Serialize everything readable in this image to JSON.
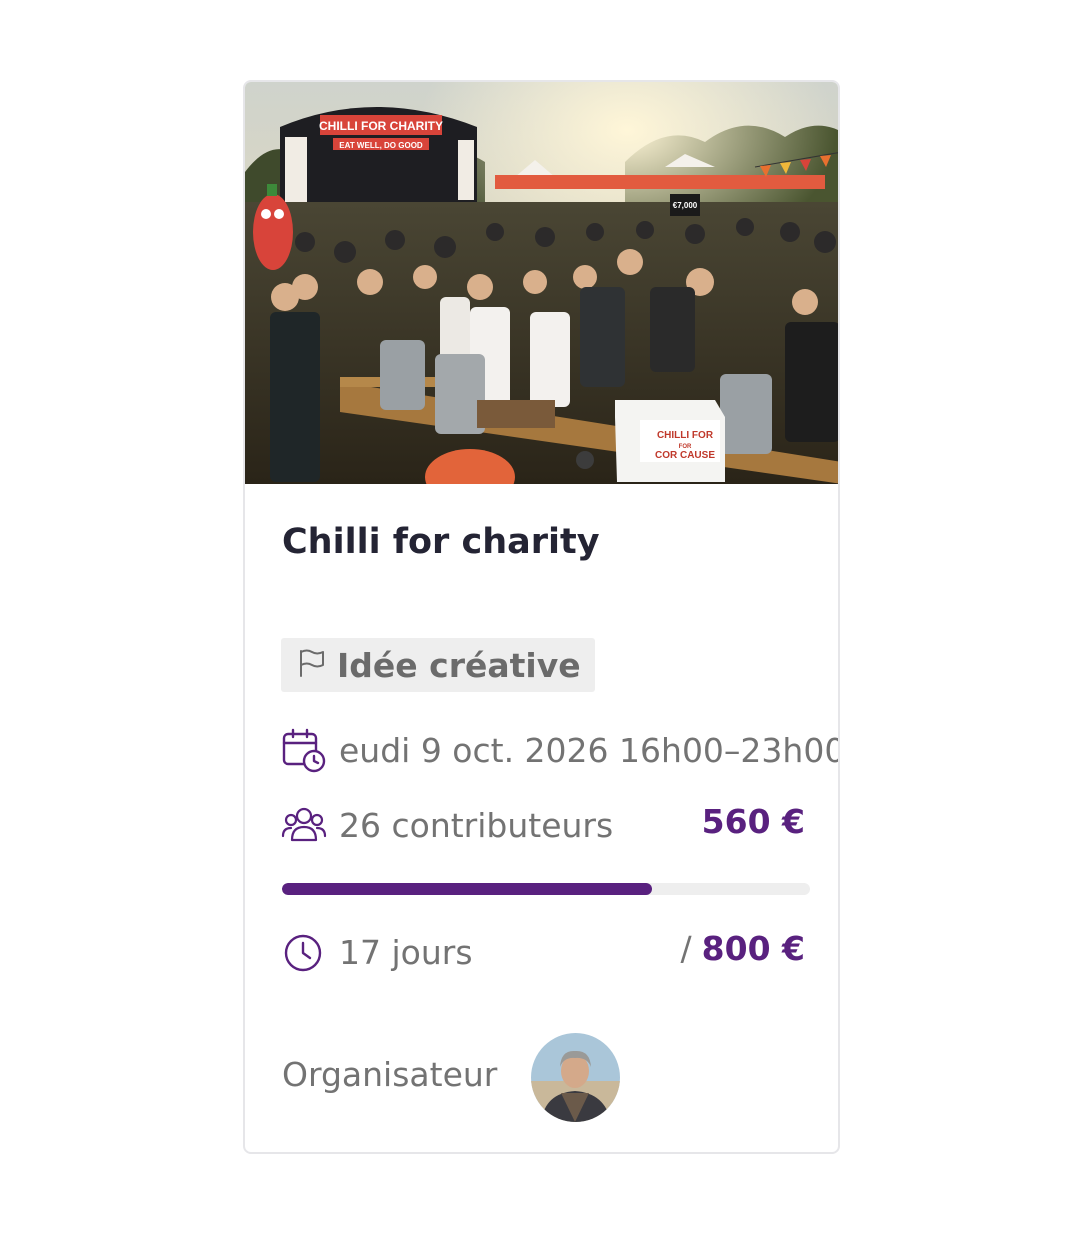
{
  "campaign": {
    "title": "Chilli for charity",
    "badge_label": "Idée créative",
    "date_text": "eudi 9 oct. 2026 16h00–23h00",
    "contributors_text": "26 contributeurs",
    "raised_amount": "560 €",
    "goal_separator": "/",
    "goal_amount": "800 €",
    "progress_fraction": 0.7,
    "days_text": "17 jours",
    "organizer_label": "Organisateur"
  },
  "hero": {
    "stage_banner": "CHILLI FOR CHARITY",
    "stage_subbanner": "EAT WELL, DO GOOD",
    "box_label_1": "CHILLI FOR",
    "box_label_2": "FOR",
    "box_label_3": "COR CAUSE",
    "sign_label": "€7,000"
  },
  "icons": {
    "badge": "flag-icon",
    "date": "calendar-clock-icon",
    "contributors": "users-icon",
    "days": "clock-icon"
  },
  "colors": {
    "accent": "#59217f",
    "title": "#242434",
    "muted": "#737373",
    "badge_bg": "#eeeeee",
    "track": "#eeeeee"
  }
}
